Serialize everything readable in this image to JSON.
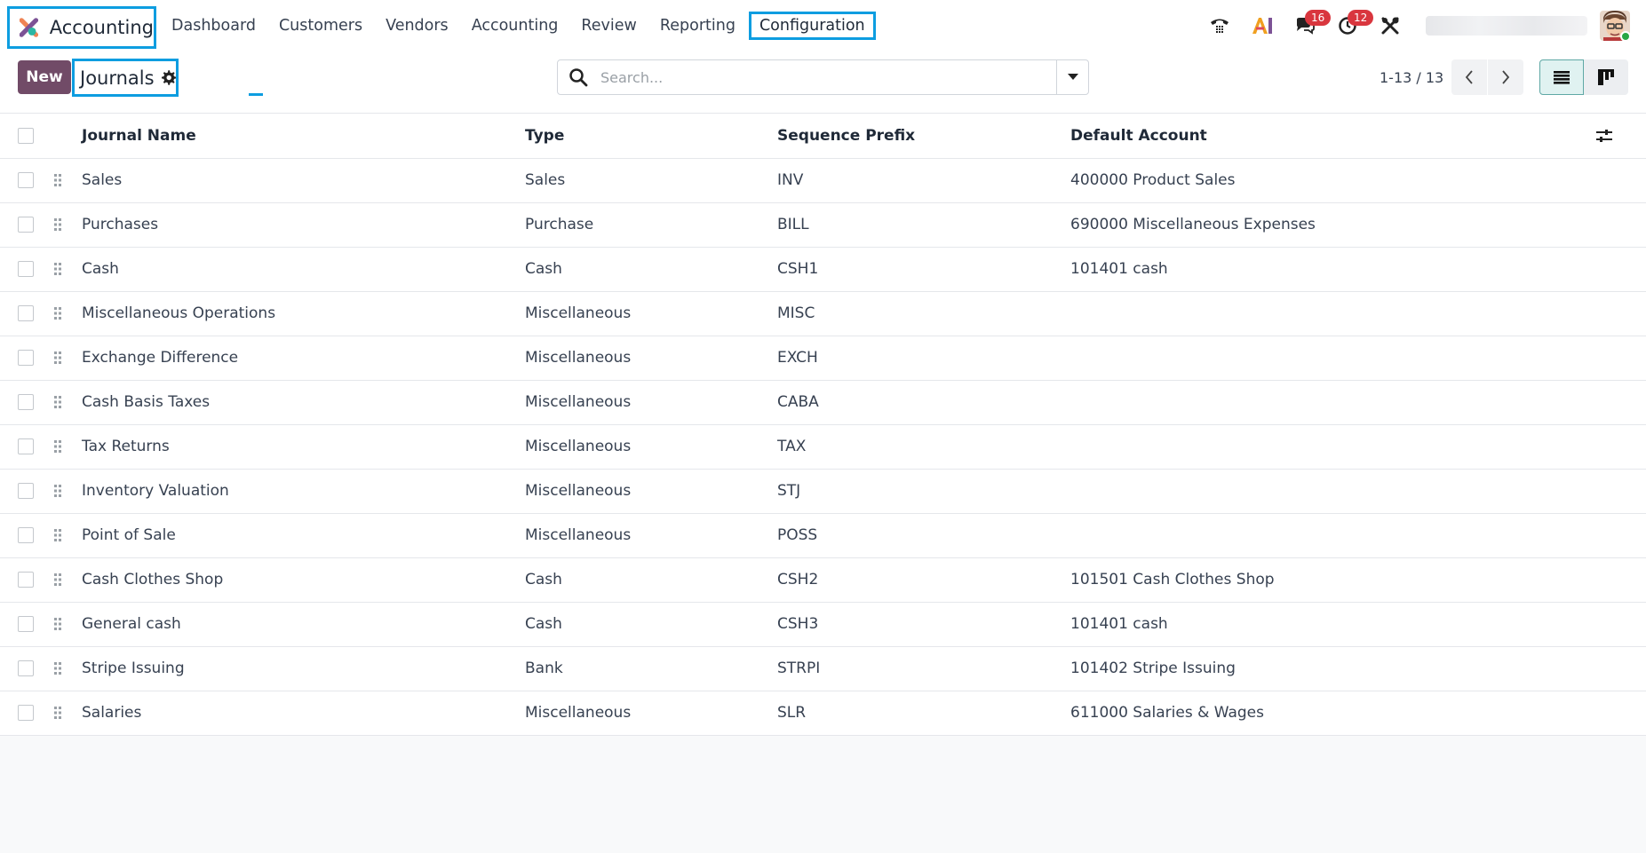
{
  "navbar": {
    "app_name": "Accounting",
    "menu": [
      {
        "label": "Dashboard"
      },
      {
        "label": "Customers"
      },
      {
        "label": "Vendors"
      },
      {
        "label": "Accounting"
      },
      {
        "label": "Review"
      },
      {
        "label": "Reporting"
      },
      {
        "label": "Configuration"
      }
    ],
    "systray": {
      "messages_count": "16",
      "activities_count": "12"
    }
  },
  "control_panel": {
    "new_label": "New",
    "breadcrumb_title": "Journals",
    "search_placeholder": "Search...",
    "pager_text": "1-13 / 13"
  },
  "list": {
    "columns": {
      "name": "Journal Name",
      "type": "Type",
      "prefix": "Sequence Prefix",
      "account": "Default Account"
    },
    "rows": [
      {
        "name": "Sales",
        "type": "Sales",
        "prefix": "INV",
        "account": "400000 Product Sales"
      },
      {
        "name": "Purchases",
        "type": "Purchase",
        "prefix": "BILL",
        "account": "690000 Miscellaneous Expenses"
      },
      {
        "name": "Cash",
        "type": "Cash",
        "prefix": "CSH1",
        "account": "101401 cash"
      },
      {
        "name": "Miscellaneous Operations",
        "type": "Miscellaneous",
        "prefix": "MISC",
        "account": ""
      },
      {
        "name": "Exchange Difference",
        "type": "Miscellaneous",
        "prefix": "EXCH",
        "account": ""
      },
      {
        "name": "Cash Basis Taxes",
        "type": "Miscellaneous",
        "prefix": "CABA",
        "account": ""
      },
      {
        "name": "Tax Returns",
        "type": "Miscellaneous",
        "prefix": "TAX",
        "account": ""
      },
      {
        "name": "Inventory Valuation",
        "type": "Miscellaneous",
        "prefix": "STJ",
        "account": ""
      },
      {
        "name": "Point of Sale",
        "type": "Miscellaneous",
        "prefix": "POSS",
        "account": ""
      },
      {
        "name": "Cash Clothes Shop",
        "type": "Cash",
        "prefix": "CSH2",
        "account": "101501 Cash Clothes Shop"
      },
      {
        "name": "General cash",
        "type": "Cash",
        "prefix": "CSH3",
        "account": "101401 cash"
      },
      {
        "name": "Stripe Issuing",
        "type": "Bank",
        "prefix": "STRPI",
        "account": "101402 Stripe Issuing"
      },
      {
        "name": "Salaries",
        "type": "Miscellaneous",
        "prefix": "SLR",
        "account": "611000 Salaries & Wages"
      }
    ]
  },
  "colors": {
    "brand": "#714b67",
    "highlight": "#0d9de0",
    "badge": "#d9363e"
  }
}
